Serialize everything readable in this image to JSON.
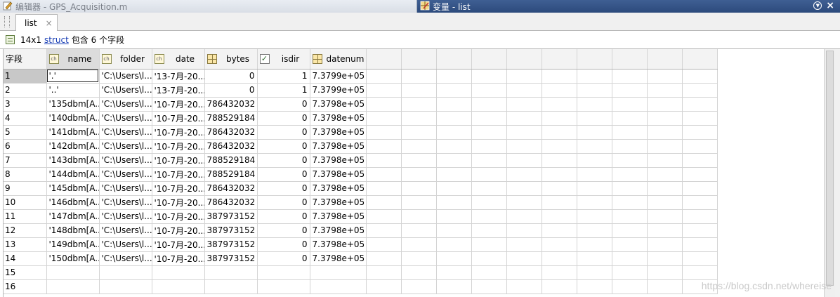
{
  "editor_title": "编辑器 - GPS_Acquisition.m",
  "variable_title": "变量 - list",
  "tab": {
    "label": "list",
    "close": "×"
  },
  "info": {
    "size": "14x1",
    "link": "struct",
    "suffix": "包含 6 个字段"
  },
  "table": {
    "row_header_label": "字段",
    "columns": [
      {
        "name": "name",
        "icon": "char-icon"
      },
      {
        "name": "folder",
        "icon": "char-icon"
      },
      {
        "name": "date",
        "icon": "char-icon"
      },
      {
        "name": "bytes",
        "icon": "numeric-grid-icon"
      },
      {
        "name": "isdir",
        "icon": "logical-check-icon"
      },
      {
        "name": "datenum",
        "icon": "numeric-grid-icon"
      }
    ],
    "rows": [
      {
        "idx": "1",
        "name": "'.'",
        "folder": "'C:\\Users\\l...",
        "date": "'13-7月-20...",
        "bytes": "0",
        "isdir": "1",
        "datenum": "7.3799e+05"
      },
      {
        "idx": "2",
        "name": "'..'",
        "folder": "'C:\\Users\\l...",
        "date": "'13-7月-20...",
        "bytes": "0",
        "isdir": "1",
        "datenum": "7.3799e+05"
      },
      {
        "idx": "3",
        "name": "'135dbm[A...",
        "folder": "'C:\\Users\\l...",
        "date": "'10-7月-20...",
        "bytes": "786432032",
        "isdir": "0",
        "datenum": "7.3798e+05"
      },
      {
        "idx": "4",
        "name": "'140dbm[A...",
        "folder": "'C:\\Users\\l...",
        "date": "'10-7月-20...",
        "bytes": "788529184",
        "isdir": "0",
        "datenum": "7.3798e+05"
      },
      {
        "idx": "5",
        "name": "'141dbm[A...",
        "folder": "'C:\\Users\\l...",
        "date": "'10-7月-20...",
        "bytes": "786432032",
        "isdir": "0",
        "datenum": "7.3798e+05"
      },
      {
        "idx": "6",
        "name": "'142dbm[A...",
        "folder": "'C:\\Users\\l...",
        "date": "'10-7月-20...",
        "bytes": "786432032",
        "isdir": "0",
        "datenum": "7.3798e+05"
      },
      {
        "idx": "7",
        "name": "'143dbm[A...",
        "folder": "'C:\\Users\\l...",
        "date": "'10-7月-20...",
        "bytes": "788529184",
        "isdir": "0",
        "datenum": "7.3798e+05"
      },
      {
        "idx": "8",
        "name": "'144dbm[A...",
        "folder": "'C:\\Users\\l...",
        "date": "'10-7月-20...",
        "bytes": "788529184",
        "isdir": "0",
        "datenum": "7.3798e+05"
      },
      {
        "idx": "9",
        "name": "'145dbm[A...",
        "folder": "'C:\\Users\\l...",
        "date": "'10-7月-20...",
        "bytes": "786432032",
        "isdir": "0",
        "datenum": "7.3798e+05"
      },
      {
        "idx": "10",
        "name": "'146dbm[A...",
        "folder": "'C:\\Users\\l...",
        "date": "'10-7月-20...",
        "bytes": "786432032",
        "isdir": "0",
        "datenum": "7.3798e+05"
      },
      {
        "idx": "11",
        "name": "'147dbm[A...",
        "folder": "'C:\\Users\\l...",
        "date": "'10-7月-20...",
        "bytes": "387973152",
        "isdir": "0",
        "datenum": "7.3798e+05"
      },
      {
        "idx": "12",
        "name": "'148dbm[A...",
        "folder": "'C:\\Users\\l...",
        "date": "'10-7月-20...",
        "bytes": "387973152",
        "isdir": "0",
        "datenum": "7.3798e+05"
      },
      {
        "idx": "13",
        "name": "'149dbm[A...",
        "folder": "'C:\\Users\\l...",
        "date": "'10-7月-20...",
        "bytes": "387973152",
        "isdir": "0",
        "datenum": "7.3798e+05"
      },
      {
        "idx": "14",
        "name": "'150dbm[A...",
        "folder": "'C:\\Users\\l...",
        "date": "'10-7月-20...",
        "bytes": "387973152",
        "isdir": "0",
        "datenum": "7.3798e+05"
      },
      {
        "idx": "15",
        "name": "",
        "folder": "",
        "date": "",
        "bytes": "",
        "isdir": "",
        "datenum": ""
      },
      {
        "idx": "16",
        "name": "",
        "folder": "",
        "date": "",
        "bytes": "",
        "isdir": "",
        "datenum": ""
      }
    ],
    "empty_columns": 10
  },
  "watermark": "https://blog.csdn.net/whereise"
}
